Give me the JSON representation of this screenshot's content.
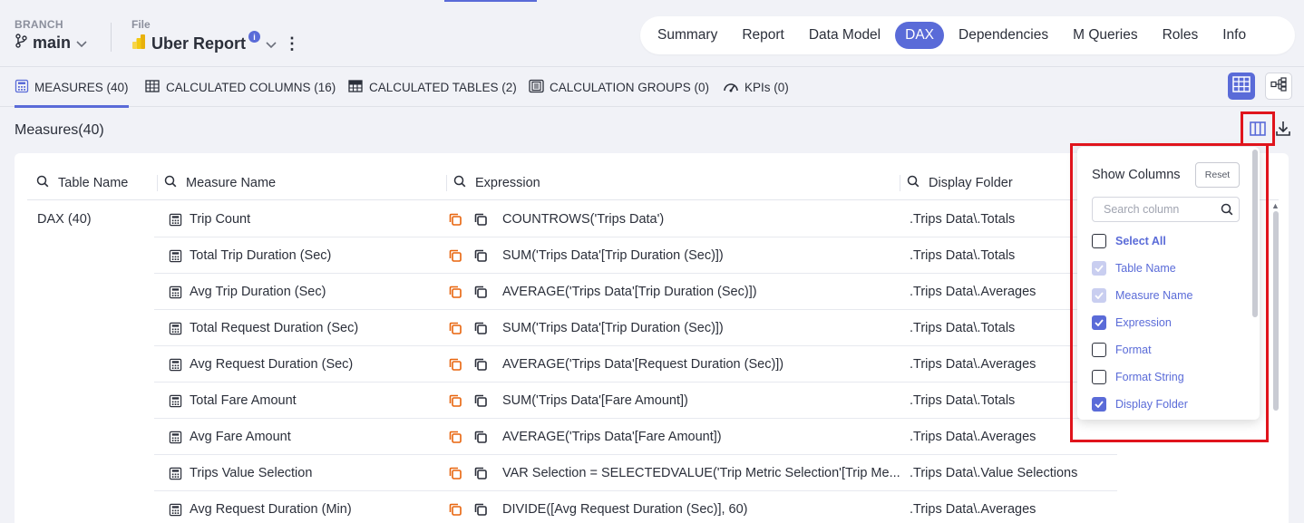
{
  "header": {
    "branch_label": "BRANCH",
    "branch_value": "main",
    "file_label": "File",
    "file_value": "Uber Report",
    "file_badge": "i"
  },
  "nav": {
    "items": [
      "Summary",
      "Report",
      "Data Model",
      "DAX",
      "Dependencies",
      "M Queries",
      "Roles",
      "Info"
    ],
    "active": "DAX"
  },
  "tabs": [
    {
      "label": "MEASURES (40)",
      "icon": "calculator-icon",
      "active": true
    },
    {
      "label": "CALCULATED COLUMNS (16)",
      "icon": "table-column-icon",
      "active": false
    },
    {
      "label": "CALCULATED TABLES (2)",
      "icon": "table-icon",
      "active": false
    },
    {
      "label": "CALCULATION GROUPS (0)",
      "icon": "calculation-group-icon",
      "active": false
    },
    {
      "label": "KPIs (0)",
      "icon": "gauge-icon",
      "active": false
    }
  ],
  "section": {
    "title": "Measures(40)"
  },
  "table": {
    "columns": [
      "Table Name",
      "Measure Name",
      "Expression",
      "Display Folder"
    ],
    "group": "DAX (40)",
    "rows": [
      {
        "name": "Trip Count",
        "expression": "COUNTROWS('Trips Data')",
        "folder": ".Trips Data\\.Totals"
      },
      {
        "name": "Total Trip Duration (Sec)",
        "expression": "SUM('Trips Data'[Trip Duration (Sec)])",
        "folder": ".Trips Data\\.Totals"
      },
      {
        "name": "Avg Trip Duration (Sec)",
        "expression": "AVERAGE('Trips Data'[Trip Duration (Sec)])",
        "folder": ".Trips Data\\.Averages"
      },
      {
        "name": "Total Request Duration (Sec)",
        "expression": "SUM('Trips Data'[Trip Duration (Sec)])",
        "folder": ".Trips Data\\.Totals"
      },
      {
        "name": "Avg Request Duration (Sec)",
        "expression": "AVERAGE('Trips Data'[Request Duration (Sec)])",
        "folder": ".Trips Data\\.Averages"
      },
      {
        "name": "Total Fare Amount",
        "expression": "SUM('Trips Data'[Fare Amount])",
        "folder": ".Trips Data\\.Totals"
      },
      {
        "name": "Avg Fare Amount",
        "expression": "AVERAGE('Trips Data'[Fare Amount])",
        "folder": ".Trips Data\\.Averages"
      },
      {
        "name": "Trips Value Selection",
        "expression": "VAR Selection = SELECTEDVALUE('Trip Metric Selection'[Trip Me...",
        "folder": ".Trips Data\\.Value Selections"
      },
      {
        "name": "Avg Request Duration (Min)",
        "expression": "DIVIDE([Avg Request Duration (Sec)], 60)",
        "folder": ".Trips Data\\.Averages"
      }
    ]
  },
  "column_picker": {
    "title": "Show Columns",
    "reset_label": "Reset",
    "search_placeholder": "Search column",
    "options": [
      {
        "label": "Select All",
        "state": "unchecked",
        "bold": true
      },
      {
        "label": "Table Name",
        "state": "disabled"
      },
      {
        "label": "Measure Name",
        "state": "disabled"
      },
      {
        "label": "Expression",
        "state": "checked"
      },
      {
        "label": "Format",
        "state": "unchecked"
      },
      {
        "label": "Format String",
        "state": "unchecked"
      },
      {
        "label": "Display Folder",
        "state": "checked"
      }
    ]
  },
  "colors": {
    "accent": "#5a6bd8",
    "highlight": "#e0141c",
    "copy_icon_orange": "#e8640c"
  }
}
